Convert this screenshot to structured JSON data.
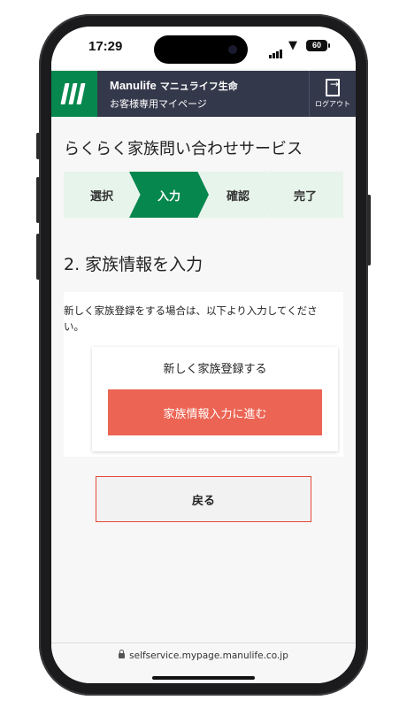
{
  "status_bar": {
    "time": "17:29",
    "battery": "60"
  },
  "header": {
    "brand": "Manulife",
    "brand_jp": "マニュライフ生命",
    "subtitle": "お客様専用マイページ",
    "logout_label": "ログアウト"
  },
  "page": {
    "title": "らくらく家族問い合わせサービス",
    "steps": [
      {
        "label": "選択",
        "active": false
      },
      {
        "label": "入力",
        "active": true
      },
      {
        "label": "確認",
        "active": false
      },
      {
        "label": "完了",
        "active": false
      }
    ],
    "section_title": "2. 家族情報を入力",
    "description": "新しく家族登録をする場合は、以下より入力してください。",
    "card_title": "新しく家族登録する",
    "proceed_button": "家族情報入力に進む",
    "back_button": "戻る"
  },
  "browser": {
    "url": "selfservice.mypage.manulife.co.jp"
  },
  "colors": {
    "brand_green": "#06874e",
    "header_navy": "#34384b",
    "cta_red": "#ec6453"
  }
}
